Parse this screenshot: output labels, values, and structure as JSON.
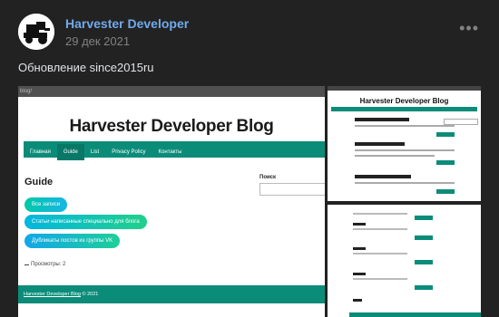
{
  "post": {
    "author": "Harvester Developer",
    "date": "29 дек 2021",
    "more_icon": "ellipsis-icon",
    "text": "Обновление since2015ru"
  },
  "screenshot_main": {
    "url_fragment": "blog/",
    "blog_title": "Harvester Developer Blog",
    "nav": [
      "Главная",
      "Guide",
      "List",
      "Privacy Policy",
      "Контакты"
    ],
    "active_nav": "Guide",
    "page_heading": "Guide",
    "search_label": "Поиск",
    "buttons": [
      "Все записи",
      "Статьи написанные специально для блога",
      "Дубликаты постов из группы VK"
    ],
    "views": "Просмотры: 2",
    "footer_link": "Harvester Developer Blog",
    "footer_suffix": " © 2021",
    "accent_color": "#0b8c79"
  },
  "screenshot_top_right": {
    "blog_title": "Harvester Developer Blog"
  }
}
